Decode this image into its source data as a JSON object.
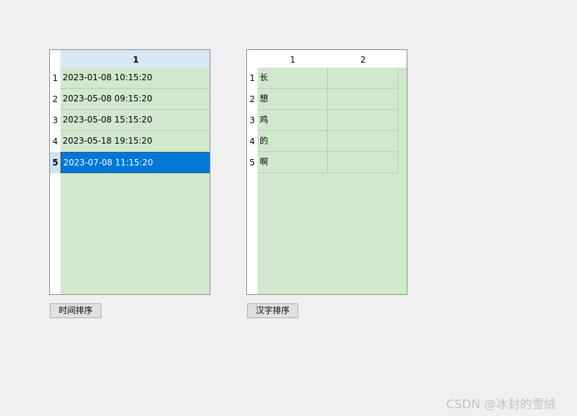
{
  "left_table": {
    "columns": [
      {
        "label": "1",
        "sort_indicator": "^"
      }
    ],
    "rows": [
      {
        "num": "1",
        "cells": [
          "2023-01-08 10:15:20"
        ]
      },
      {
        "num": "2",
        "cells": [
          "2023-05-08 09:15:20"
        ]
      },
      {
        "num": "3",
        "cells": [
          "2023-05-08 15:15:20"
        ]
      },
      {
        "num": "4",
        "cells": [
          "2023-05-18 19:15:20"
        ]
      },
      {
        "num": "5",
        "cells": [
          "2023-07-08 11:15:20"
        ]
      }
    ],
    "selected_row": 5,
    "button_label": "时间排序"
  },
  "right_table": {
    "columns": [
      {
        "label": "1",
        "sort_indicator": "ˇ"
      },
      {
        "label": "2",
        "sort_indicator": ""
      }
    ],
    "rows": [
      {
        "num": "1",
        "cells": [
          "长",
          ""
        ]
      },
      {
        "num": "2",
        "cells": [
          "想",
          ""
        ]
      },
      {
        "num": "3",
        "cells": [
          "鸡",
          ""
        ]
      },
      {
        "num": "4",
        "cells": [
          "的",
          ""
        ]
      },
      {
        "num": "5",
        "cells": [
          "啊",
          ""
        ]
      }
    ],
    "button_label": "汉字排序"
  },
  "colors": {
    "window_background": "#f0f0f0",
    "grid_background": "#d0e9cd",
    "selection": "#0078d7",
    "header_selected": "#d7e8f6",
    "row_header_selected": "#cde4f7"
  },
  "icons": {
    "sort_ascending": "sort-ascending-icon",
    "sort_descending": "sort-descending-icon"
  },
  "watermark": "CSDN @冰封的雪绒"
}
